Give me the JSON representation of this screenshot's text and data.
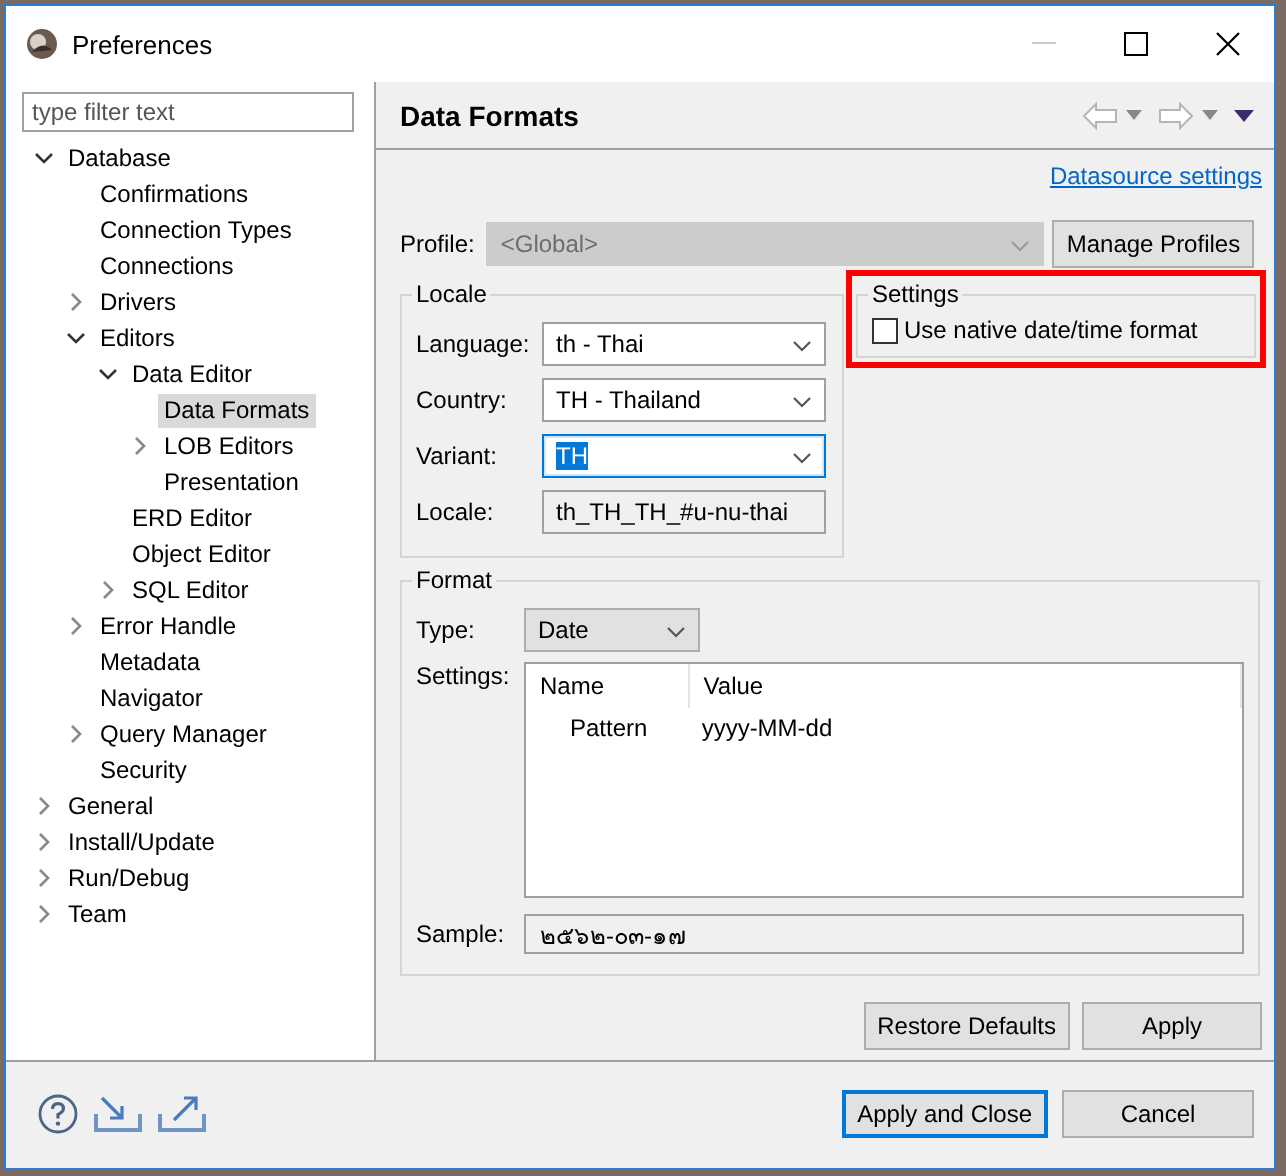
{
  "window": {
    "title": "Preferences"
  },
  "filter": {
    "placeholder": "type filter text"
  },
  "tree": [
    {
      "label": "Database",
      "expanded": true,
      "selected": false,
      "children": [
        {
          "label": "Confirmations",
          "selected": false
        },
        {
          "label": "Connection Types",
          "selected": false
        },
        {
          "label": "Connections",
          "selected": false
        },
        {
          "label": "Drivers",
          "expanded": false,
          "selected": false
        },
        {
          "label": "Editors",
          "expanded": true,
          "selected": false,
          "children": [
            {
              "label": "Data Editor",
              "expanded": true,
              "selected": false,
              "children": [
                {
                  "label": "Data Formats",
                  "selected": true
                },
                {
                  "label": "LOB Editors",
                  "expanded": false,
                  "selected": false
                },
                {
                  "label": "Presentation",
                  "selected": false
                }
              ]
            },
            {
              "label": "ERD Editor",
              "selected": false
            },
            {
              "label": "Object Editor",
              "selected": false
            },
            {
              "label": "SQL Editor",
              "expanded": false,
              "selected": false
            }
          ]
        },
        {
          "label": "Error Handle",
          "expanded": false,
          "selected": false
        },
        {
          "label": "Metadata",
          "selected": false
        },
        {
          "label": "Navigator",
          "selected": false
        },
        {
          "label": "Query Manager",
          "expanded": false,
          "selected": false
        },
        {
          "label": "Security",
          "selected": false
        }
      ]
    },
    {
      "label": "General",
      "expanded": false,
      "selected": false
    },
    {
      "label": "Install/Update",
      "expanded": false,
      "selected": false
    },
    {
      "label": "Run/Debug",
      "expanded": false,
      "selected": false
    },
    {
      "label": "Team",
      "expanded": false,
      "selected": false
    }
  ],
  "page": {
    "title": "Data Formats",
    "link": "Datasource settings",
    "profile": {
      "label": "Profile:",
      "value": "<Global>",
      "disabled": true
    },
    "manage_button": "Manage Profiles",
    "locale": {
      "title": "Locale",
      "fields": [
        {
          "label": "Language:",
          "value": "th - Thai",
          "kind": "combo",
          "focused": false
        },
        {
          "label": "Country:",
          "value": "TH - Thailand",
          "kind": "combo",
          "focused": false
        },
        {
          "label": "Variant:",
          "value": "TH",
          "kind": "combo",
          "focused": true
        },
        {
          "label": "Locale:",
          "value": "th_TH_TH_#u-nu-thai",
          "kind": "readonly"
        }
      ]
    },
    "settings": {
      "title": "Settings",
      "highlighted": true,
      "options": [
        {
          "label": "Use native date/time format",
          "checked": false
        }
      ]
    },
    "format": {
      "title": "Format",
      "type_label": "Type:",
      "type_value": "Date",
      "settings_label": "Settings:",
      "columns": [
        "Name",
        "Value"
      ],
      "rows": [
        [
          "Pattern",
          "yyyy-MM-dd"
        ]
      ],
      "sample_label": "Sample:",
      "sample_value": "๒๕๖๒-๐๓-๑๗"
    },
    "buttons": [
      "Restore Defaults",
      "Apply"
    ]
  },
  "footer": {
    "buttons": [
      {
        "label": "Apply and Close",
        "default": true
      },
      {
        "label": "Cancel",
        "default": false
      }
    ]
  }
}
